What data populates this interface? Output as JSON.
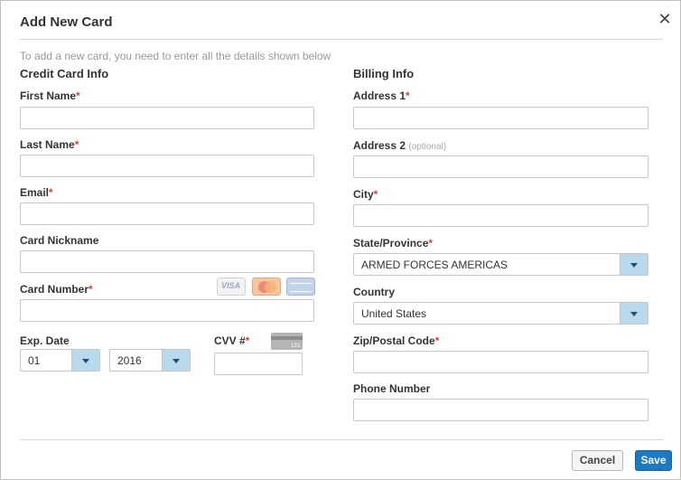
{
  "dialog": {
    "title": "Add New Card",
    "close_glyph": "✕",
    "intro": "To add a new card, you need to enter all the details shown below"
  },
  "credit_card": {
    "heading": "Credit Card Info",
    "first_name": {
      "label": "First Name",
      "required": "*",
      "value": ""
    },
    "last_name": {
      "label": "Last Name",
      "required": "*",
      "value": ""
    },
    "email": {
      "label": "Email",
      "required": "*",
      "value": ""
    },
    "nickname": {
      "label": "Card Nickname",
      "value": ""
    },
    "card_number": {
      "label": "Card Number",
      "required": "*",
      "value": ""
    },
    "card_brands": {
      "visa_text": "VISA",
      "icons": [
        "visa-icon",
        "mastercard-icon",
        "amex-icon"
      ]
    },
    "exp_date": {
      "label": "Exp. Date",
      "month": "01",
      "year": "2016"
    },
    "cvv": {
      "label": "CVV #",
      "required": "*",
      "value": "",
      "icon_text": "123"
    }
  },
  "billing": {
    "heading": "Billing Info",
    "address1": {
      "label": "Address 1",
      "required": "*",
      "value": ""
    },
    "address2": {
      "label": "Address 2",
      "optional": "(optional)",
      "value": ""
    },
    "city": {
      "label": "City",
      "required": "*",
      "value": ""
    },
    "state": {
      "label": "State/Province",
      "required": "*",
      "value": "ARMED FORCES AMERICAS"
    },
    "country": {
      "label": "Country",
      "value": "United States"
    },
    "zip": {
      "label": "Zip/Postal Code",
      "required": "*",
      "value": ""
    },
    "phone": {
      "label": "Phone Number",
      "value": ""
    }
  },
  "footer": {
    "cancel_label": "Cancel",
    "save_label": "Save"
  },
  "colors": {
    "required": "#d9443a",
    "save_button": "#1b7ac2",
    "select_caret": "#b9d9ec"
  }
}
